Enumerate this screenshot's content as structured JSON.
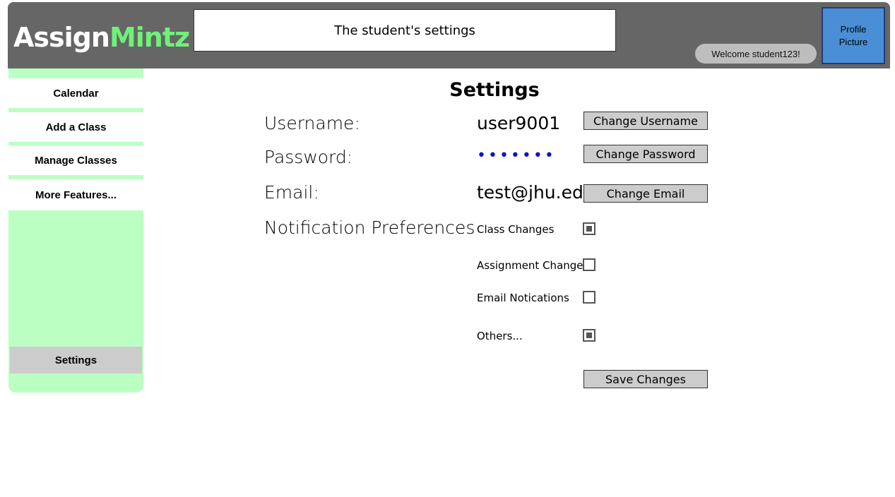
{
  "header": {
    "logo_part1": "Assign",
    "logo_part2": "Mintz",
    "title": "The student's settings",
    "welcome": "Welcome student123!",
    "profile_picture": "Profile Picture"
  },
  "sidebar": {
    "items": [
      {
        "label": "Calendar"
      },
      {
        "label": "Add a Class"
      },
      {
        "label": "Manage Classes"
      },
      {
        "label": "More Features..."
      },
      {
        "label": "Settings"
      }
    ]
  },
  "settings": {
    "heading": "Settings",
    "username_label": "Username:",
    "username_value": "user9001",
    "change_username": "Change Username",
    "password_label": "Password:",
    "password_value": "•••••••",
    "change_password": "Change Password",
    "email_label": "Email:",
    "email_value": "test@jhu.edu",
    "change_email": "Change Email",
    "notification_label": "Notification Preferences",
    "preferences": [
      {
        "label": "Class Changes",
        "checked": true
      },
      {
        "label": "Assignment Changes",
        "checked": false
      },
      {
        "label": "Email Notications",
        "checked": false
      },
      {
        "label": "Others...",
        "checked": true
      }
    ],
    "save_changes": "Save Changes"
  },
  "colors": {
    "header_bg": "#666666",
    "logo_accent": "#6ef27a",
    "sidebar_bg": "#bcffc2",
    "profile_bg": "#4a8fd6",
    "button_bg": "#cccccc",
    "password_dots": "#1010d0"
  }
}
